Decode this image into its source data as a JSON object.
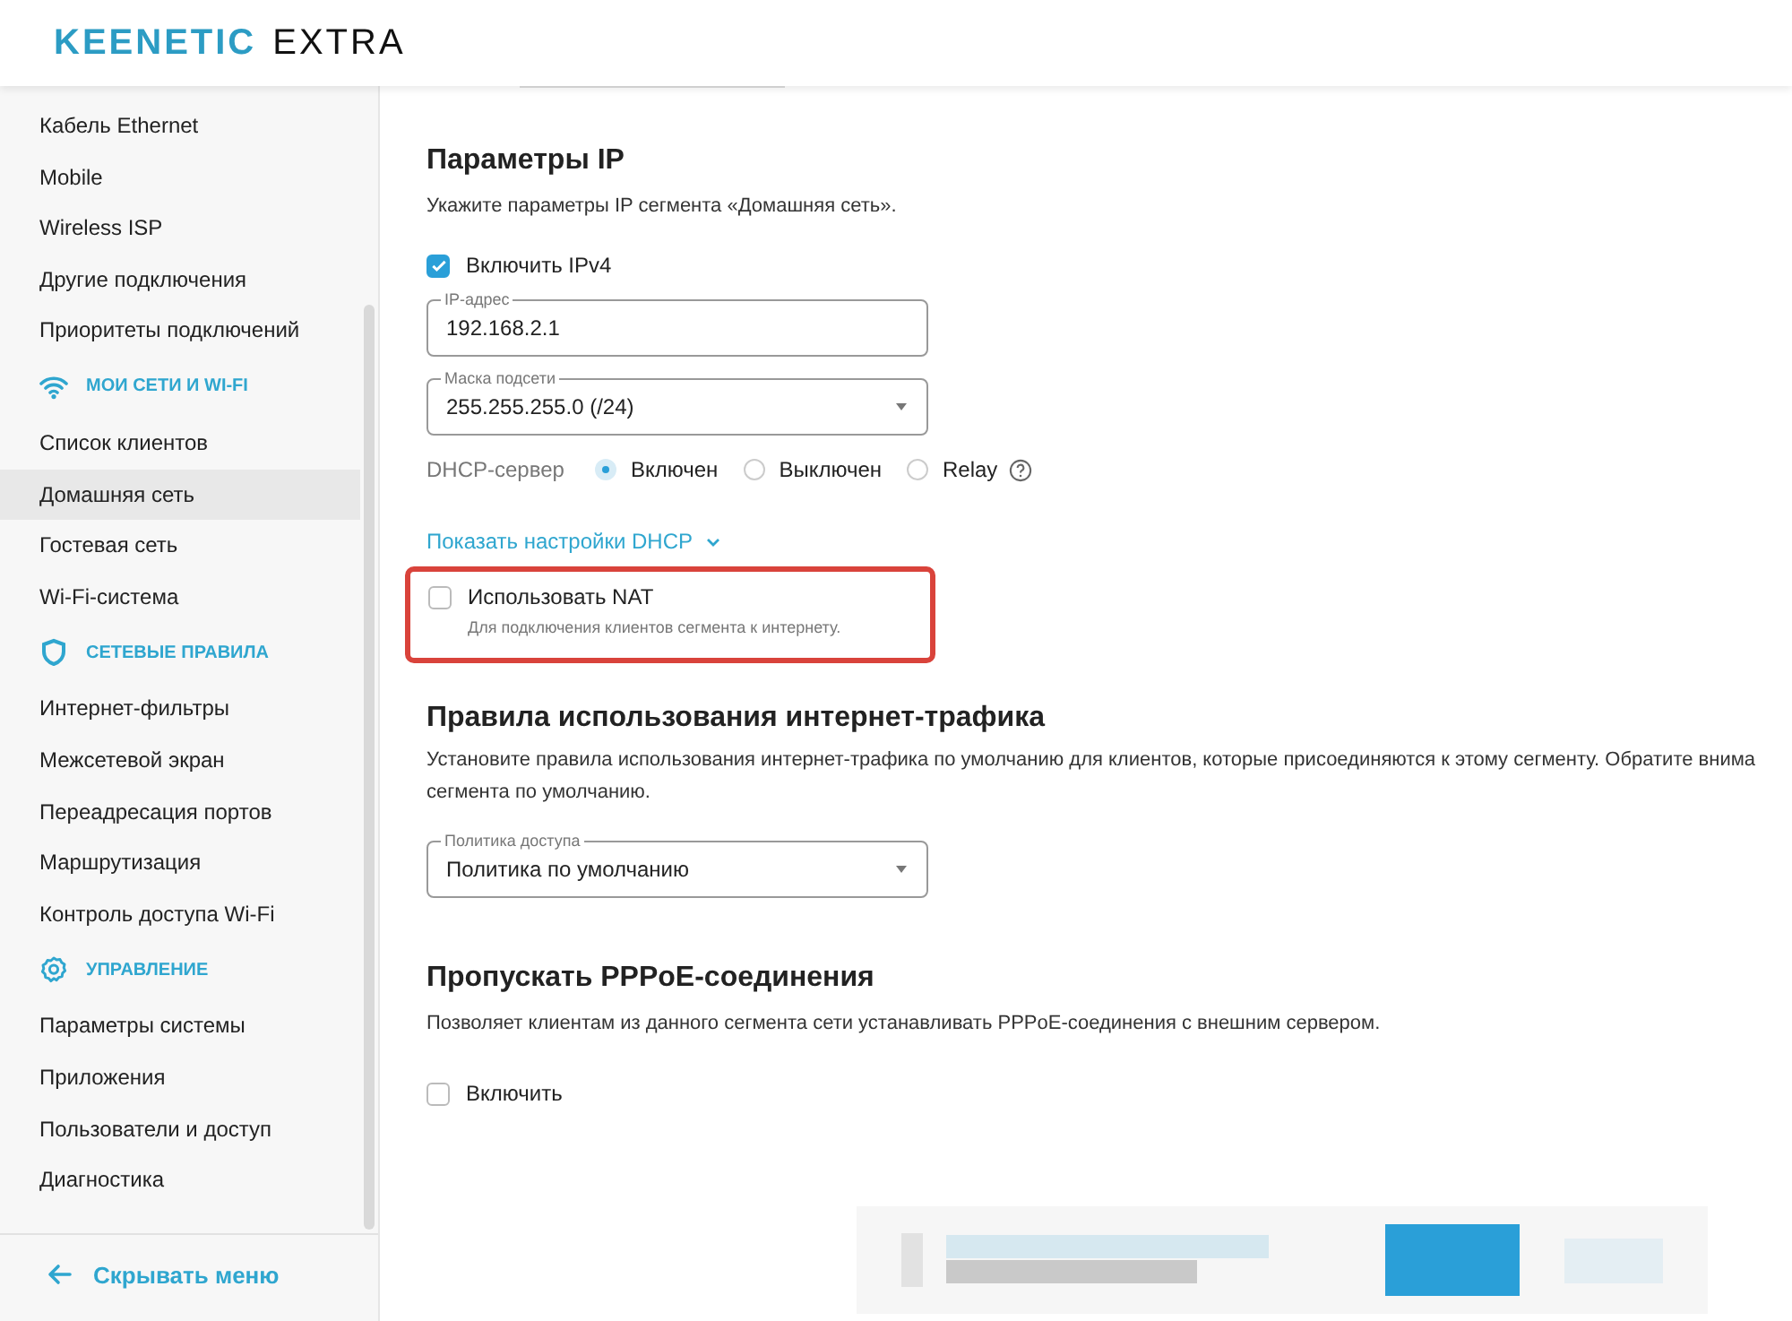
{
  "header": {
    "brand": "KEENETIC",
    "model": "EXTRA"
  },
  "sidebar": {
    "items": [
      {
        "kind": "item",
        "label": "Кабель Ethernet",
        "selected": false
      },
      {
        "kind": "item",
        "label": "Mobile",
        "selected": false
      },
      {
        "kind": "item",
        "label": "Wireless ISP",
        "selected": false
      },
      {
        "kind": "item",
        "label": "Другие подключения",
        "selected": false
      },
      {
        "kind": "item",
        "label": "Приоритеты подключений",
        "selected": false
      },
      {
        "kind": "section",
        "label": "МОИ СЕТИ И WI-FI"
      },
      {
        "kind": "item",
        "label": "Список клиентов",
        "selected": false
      },
      {
        "kind": "item",
        "label": "Домашняя сеть",
        "selected": true
      },
      {
        "kind": "item",
        "label": "Гостевая сеть",
        "selected": false
      },
      {
        "kind": "item",
        "label": "Wi-Fi-система",
        "selected": false
      },
      {
        "kind": "section",
        "label": "СЕТЕВЫЕ ПРАВИЛА"
      },
      {
        "kind": "item",
        "label": "Интернет-фильтры",
        "selected": false
      },
      {
        "kind": "item",
        "label": "Межсетевой экран",
        "selected": false
      },
      {
        "kind": "item",
        "label": "Переадресация портов",
        "selected": false
      },
      {
        "kind": "item",
        "label": "Маршрутизация",
        "selected": false
      },
      {
        "kind": "item",
        "label": "Контроль доступа Wi-Fi",
        "selected": false
      },
      {
        "kind": "section",
        "label": "УПРАВЛЕНИЕ"
      },
      {
        "kind": "item",
        "label": "Параметры системы",
        "selected": false
      },
      {
        "kind": "item",
        "label": "Приложения",
        "selected": false
      },
      {
        "kind": "item",
        "label": "Пользователи и доступ",
        "selected": false
      },
      {
        "kind": "item",
        "label": "Диагностика",
        "selected": false
      }
    ],
    "footer": "Скрывать меню"
  },
  "ip": {
    "title": "Параметры IP",
    "description": "Укажите параметры IP сегмента «Домашняя сеть».",
    "ipv4": {
      "label": "Включить IPv4",
      "checked": true
    },
    "address": {
      "label": "IP-адрес",
      "value": "192.168.2.1"
    },
    "mask": {
      "label": "Маска подсети",
      "value": "255.255.255.0 (/24)"
    },
    "dhcp": {
      "label": "DHCP-сервер",
      "options": [
        {
          "label": "Включен",
          "selected": true
        },
        {
          "label": "Выключен",
          "selected": false
        },
        {
          "label": "Relay",
          "selected": false
        }
      ]
    },
    "dhcp_link": "Показать настройки DHCP",
    "nat": {
      "label": "Использовать NAT",
      "hint": "Для подключения клиентов сегмента к интернету.",
      "checked": false
    }
  },
  "traffic": {
    "title": "Правила использования интернет-трафика",
    "description_lines": [
      "Установите правила использования интернет-трафика по умолчанию для клиентов, которые присоединяются к этому сегменту. Обратите внима",
      "сегмента по умолчанию."
    ],
    "policy": {
      "label": "Политика доступа",
      "value": "Политика по умолчанию"
    }
  },
  "pppoe": {
    "title": "Пропускать PPPoE-соединения",
    "description": "Позволяет клиентам из данного сегмента сети устанавливать PPPoE-соединения с внешним сервером.",
    "enable": {
      "label": "Включить",
      "checked": false
    }
  }
}
